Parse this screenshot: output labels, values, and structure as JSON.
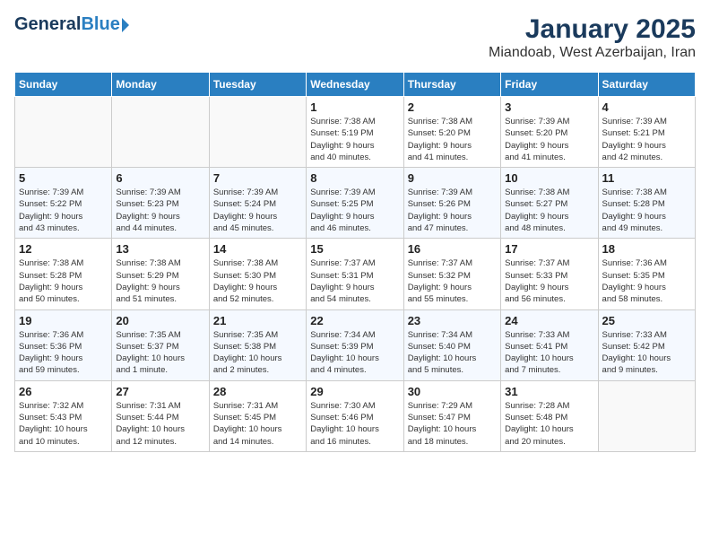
{
  "header": {
    "logo_general": "General",
    "logo_blue": "Blue",
    "title": "January 2025",
    "subtitle": "Miandoab, West Azerbaijan, Iran"
  },
  "days_of_week": [
    "Sunday",
    "Monday",
    "Tuesday",
    "Wednesday",
    "Thursday",
    "Friday",
    "Saturday"
  ],
  "weeks": [
    [
      {
        "day": "",
        "info": ""
      },
      {
        "day": "",
        "info": ""
      },
      {
        "day": "",
        "info": ""
      },
      {
        "day": "1",
        "info": "Sunrise: 7:38 AM\nSunset: 5:19 PM\nDaylight: 9 hours\nand 40 minutes."
      },
      {
        "day": "2",
        "info": "Sunrise: 7:38 AM\nSunset: 5:20 PM\nDaylight: 9 hours\nand 41 minutes."
      },
      {
        "day": "3",
        "info": "Sunrise: 7:39 AM\nSunset: 5:20 PM\nDaylight: 9 hours\nand 41 minutes."
      },
      {
        "day": "4",
        "info": "Sunrise: 7:39 AM\nSunset: 5:21 PM\nDaylight: 9 hours\nand 42 minutes."
      }
    ],
    [
      {
        "day": "5",
        "info": "Sunrise: 7:39 AM\nSunset: 5:22 PM\nDaylight: 9 hours\nand 43 minutes."
      },
      {
        "day": "6",
        "info": "Sunrise: 7:39 AM\nSunset: 5:23 PM\nDaylight: 9 hours\nand 44 minutes."
      },
      {
        "day": "7",
        "info": "Sunrise: 7:39 AM\nSunset: 5:24 PM\nDaylight: 9 hours\nand 45 minutes."
      },
      {
        "day": "8",
        "info": "Sunrise: 7:39 AM\nSunset: 5:25 PM\nDaylight: 9 hours\nand 46 minutes."
      },
      {
        "day": "9",
        "info": "Sunrise: 7:39 AM\nSunset: 5:26 PM\nDaylight: 9 hours\nand 47 minutes."
      },
      {
        "day": "10",
        "info": "Sunrise: 7:38 AM\nSunset: 5:27 PM\nDaylight: 9 hours\nand 48 minutes."
      },
      {
        "day": "11",
        "info": "Sunrise: 7:38 AM\nSunset: 5:28 PM\nDaylight: 9 hours\nand 49 minutes."
      }
    ],
    [
      {
        "day": "12",
        "info": "Sunrise: 7:38 AM\nSunset: 5:28 PM\nDaylight: 9 hours\nand 50 minutes."
      },
      {
        "day": "13",
        "info": "Sunrise: 7:38 AM\nSunset: 5:29 PM\nDaylight: 9 hours\nand 51 minutes."
      },
      {
        "day": "14",
        "info": "Sunrise: 7:38 AM\nSunset: 5:30 PM\nDaylight: 9 hours\nand 52 minutes."
      },
      {
        "day": "15",
        "info": "Sunrise: 7:37 AM\nSunset: 5:31 PM\nDaylight: 9 hours\nand 54 minutes."
      },
      {
        "day": "16",
        "info": "Sunrise: 7:37 AM\nSunset: 5:32 PM\nDaylight: 9 hours\nand 55 minutes."
      },
      {
        "day": "17",
        "info": "Sunrise: 7:37 AM\nSunset: 5:33 PM\nDaylight: 9 hours\nand 56 minutes."
      },
      {
        "day": "18",
        "info": "Sunrise: 7:36 AM\nSunset: 5:35 PM\nDaylight: 9 hours\nand 58 minutes."
      }
    ],
    [
      {
        "day": "19",
        "info": "Sunrise: 7:36 AM\nSunset: 5:36 PM\nDaylight: 9 hours\nand 59 minutes."
      },
      {
        "day": "20",
        "info": "Sunrise: 7:35 AM\nSunset: 5:37 PM\nDaylight: 10 hours\nand 1 minute."
      },
      {
        "day": "21",
        "info": "Sunrise: 7:35 AM\nSunset: 5:38 PM\nDaylight: 10 hours\nand 2 minutes."
      },
      {
        "day": "22",
        "info": "Sunrise: 7:34 AM\nSunset: 5:39 PM\nDaylight: 10 hours\nand 4 minutes."
      },
      {
        "day": "23",
        "info": "Sunrise: 7:34 AM\nSunset: 5:40 PM\nDaylight: 10 hours\nand 5 minutes."
      },
      {
        "day": "24",
        "info": "Sunrise: 7:33 AM\nSunset: 5:41 PM\nDaylight: 10 hours\nand 7 minutes."
      },
      {
        "day": "25",
        "info": "Sunrise: 7:33 AM\nSunset: 5:42 PM\nDaylight: 10 hours\nand 9 minutes."
      }
    ],
    [
      {
        "day": "26",
        "info": "Sunrise: 7:32 AM\nSunset: 5:43 PM\nDaylight: 10 hours\nand 10 minutes."
      },
      {
        "day": "27",
        "info": "Sunrise: 7:31 AM\nSunset: 5:44 PM\nDaylight: 10 hours\nand 12 minutes."
      },
      {
        "day": "28",
        "info": "Sunrise: 7:31 AM\nSunset: 5:45 PM\nDaylight: 10 hours\nand 14 minutes."
      },
      {
        "day": "29",
        "info": "Sunrise: 7:30 AM\nSunset: 5:46 PM\nDaylight: 10 hours\nand 16 minutes."
      },
      {
        "day": "30",
        "info": "Sunrise: 7:29 AM\nSunset: 5:47 PM\nDaylight: 10 hours\nand 18 minutes."
      },
      {
        "day": "31",
        "info": "Sunrise: 7:28 AM\nSunset: 5:48 PM\nDaylight: 10 hours\nand 20 minutes."
      },
      {
        "day": "",
        "info": ""
      }
    ]
  ]
}
